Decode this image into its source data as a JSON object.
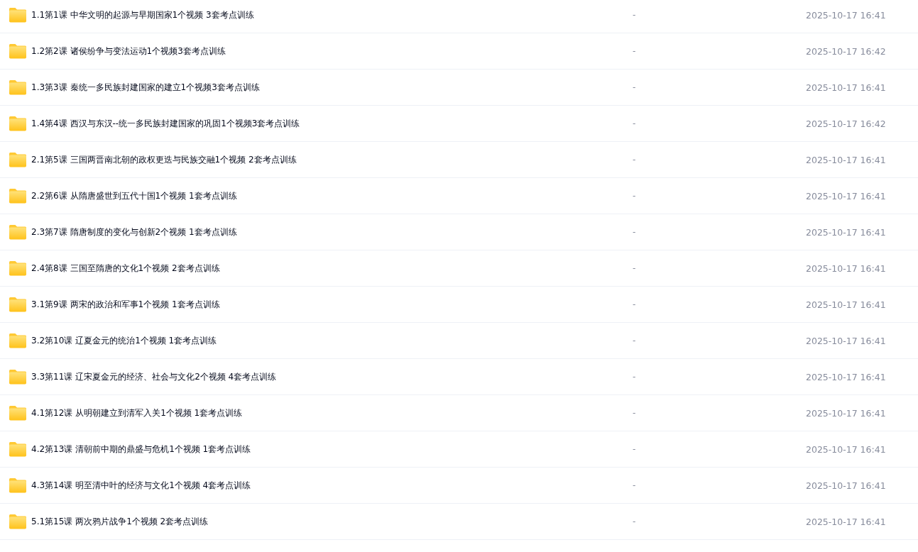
{
  "files": [
    {
      "name": "1.1第1课 中华文明的起源与早期国家1个视频 3套考点训练",
      "size": "-",
      "modified": "2025-10-17 16:41"
    },
    {
      "name": "1.2第2课 诸侯纷争与变法运动1个视频3套考点训练",
      "size": "-",
      "modified": "2025-10-17 16:42"
    },
    {
      "name": "1.3第3课 秦统一多民族封建国家的建立1个视频3套考点训练",
      "size": "-",
      "modified": "2025-10-17 16:41"
    },
    {
      "name": "1.4第4课 西汉与东汉--统一多民族封建国家的巩固1个视频3套考点训练",
      "size": "-",
      "modified": "2025-10-17 16:42"
    },
    {
      "name": "2.1第5课 三国两晋南北朝的政权更迭与民族交融1个视频 2套考点训练",
      "size": "-",
      "modified": "2025-10-17 16:41"
    },
    {
      "name": "2.2第6课 从隋唐盛世到五代十国1个视频 1套考点训练",
      "size": "-",
      "modified": "2025-10-17 16:41"
    },
    {
      "name": "2.3第7课 隋唐制度的变化与创新2个视频 1套考点训练",
      "size": "-",
      "modified": "2025-10-17 16:41"
    },
    {
      "name": "2.4第8课 三国至隋唐的文化1个视频 2套考点训练",
      "size": "-",
      "modified": "2025-10-17 16:41"
    },
    {
      "name": "3.1第9课 两宋的政治和军事1个视频 1套考点训练",
      "size": "-",
      "modified": "2025-10-17 16:41"
    },
    {
      "name": "3.2第10课 辽夏金元的统治1个视频 1套考点训练",
      "size": "-",
      "modified": "2025-10-17 16:41"
    },
    {
      "name": "3.3第11课 辽宋夏金元的经济、社会与文化2个视频 4套考点训练",
      "size": "-",
      "modified": "2025-10-17 16:41"
    },
    {
      "name": "4.1第12课 从明朝建立到清军入关1个视频 1套考点训练",
      "size": "-",
      "modified": "2025-10-17 16:41"
    },
    {
      "name": "4.2第13课 清朝前中期的鼎盛与危机1个视频 1套考点训练",
      "size": "-",
      "modified": "2025-10-17 16:41"
    },
    {
      "name": "4.3第14课 明至清中叶的经济与文化1个视频 4套考点训练",
      "size": "-",
      "modified": "2025-10-17 16:41"
    },
    {
      "name": "5.1第15课 两次鸦片战争1个视频 2套考点训练",
      "size": "-",
      "modified": "2025-10-17 16:41"
    }
  ]
}
